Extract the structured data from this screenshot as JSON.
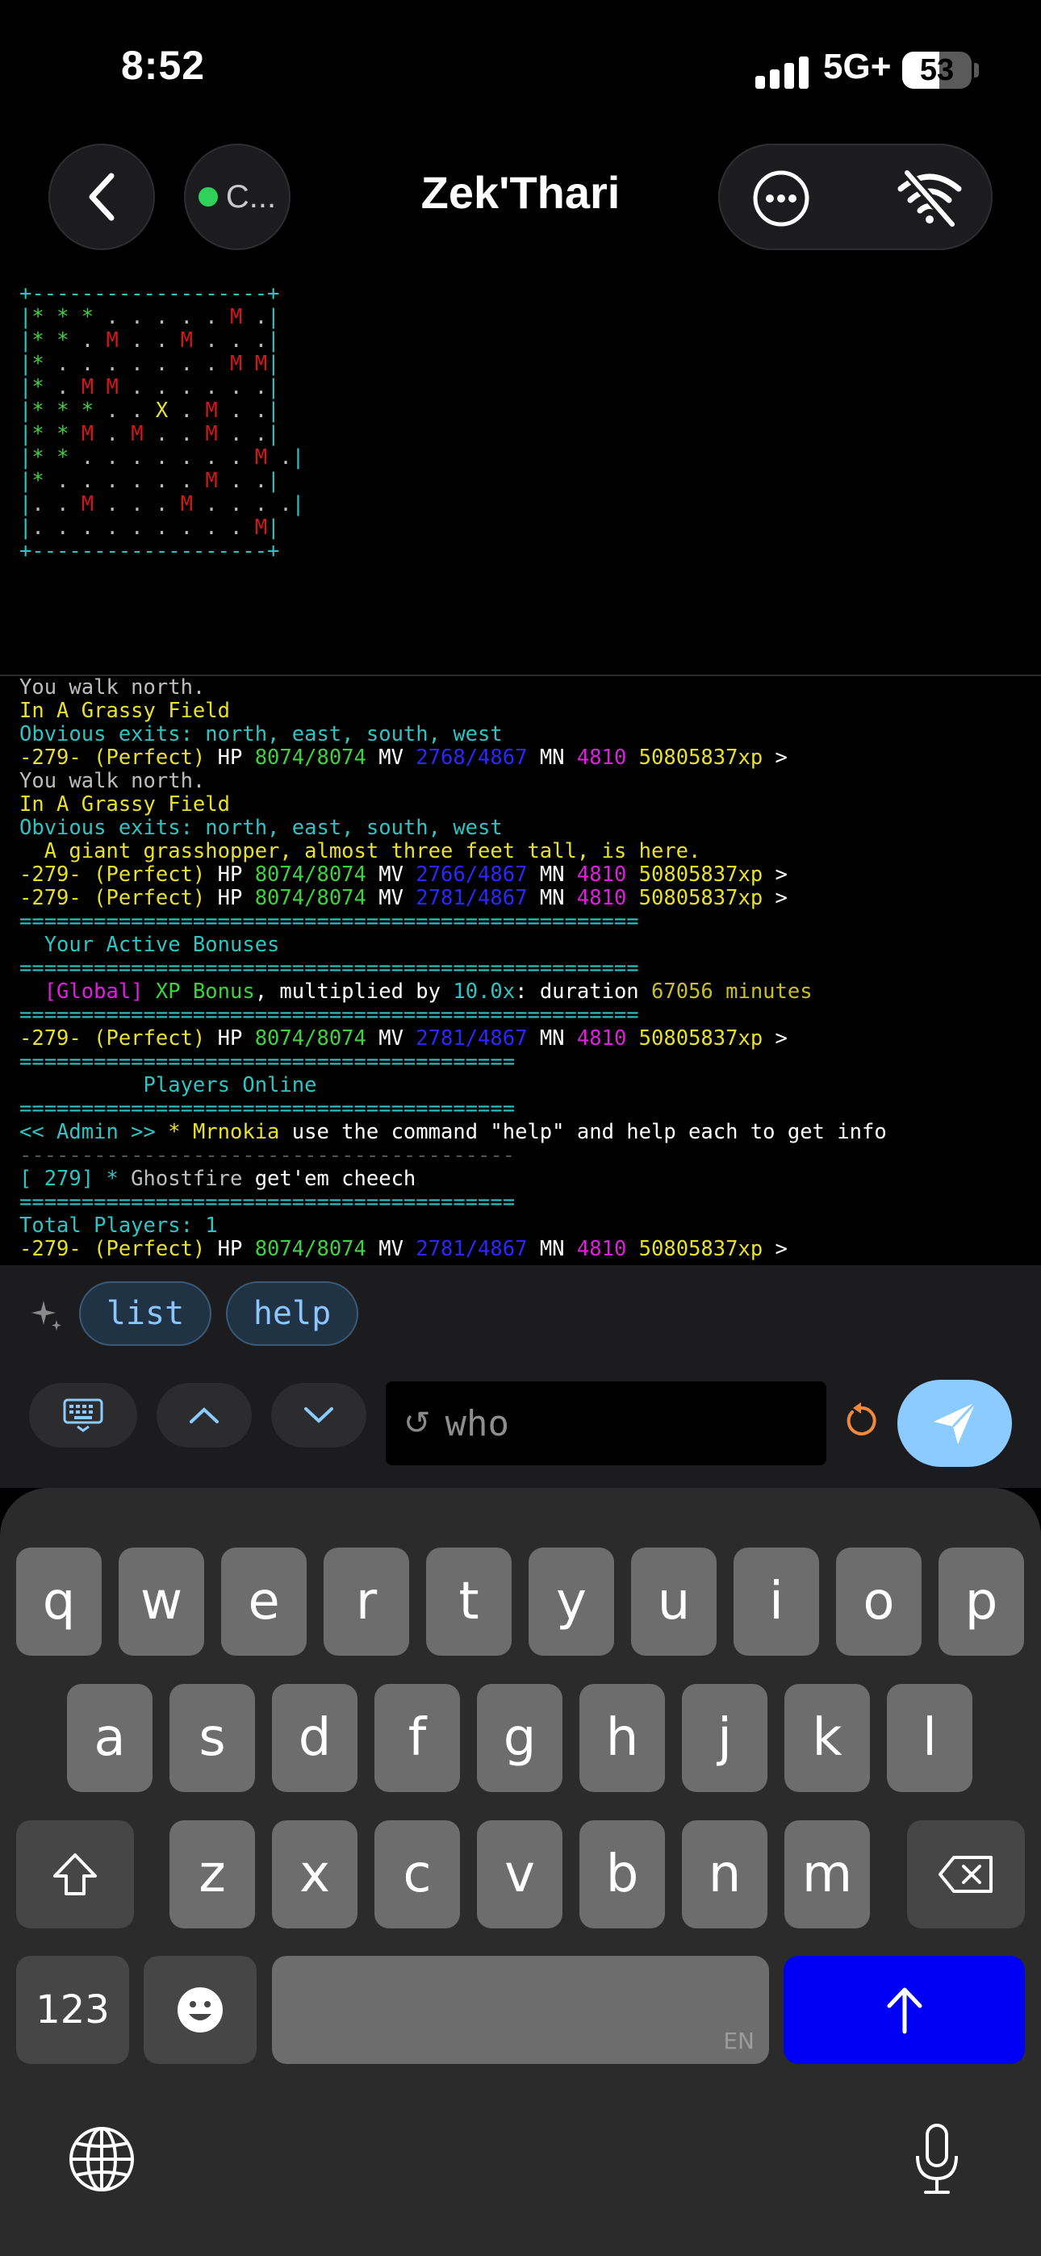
{
  "status_bar": {
    "time": "8:52",
    "network": "5G+",
    "battery": "53",
    "battery_level": 0.53
  },
  "nav": {
    "title": "Zek'Thari",
    "connection_label": "C..."
  },
  "map_lines": [
    [
      {
        "t": "+-------------------+",
        "c": "cyan"
      }
    ],
    [
      {
        "t": "|",
        "c": "cyan"
      },
      {
        "t": "* * * ",
        "c": "green"
      },
      {
        "t": ". . . . . ",
        "c": "gray"
      },
      {
        "t": "M",
        "c": "red"
      },
      {
        "t": " .",
        "c": "gray"
      },
      {
        "t": "|",
        "c": "cyan"
      }
    ],
    [
      {
        "t": "|",
        "c": "cyan"
      },
      {
        "t": "* * ",
        "c": "green"
      },
      {
        "t": ". ",
        "c": "gray"
      },
      {
        "t": "M",
        "c": "red"
      },
      {
        "t": " . . ",
        "c": "gray"
      },
      {
        "t": "M",
        "c": "red"
      },
      {
        "t": " . . .",
        "c": "gray"
      },
      {
        "t": "|",
        "c": "cyan"
      }
    ],
    [
      {
        "t": "|",
        "c": "cyan"
      },
      {
        "t": "* ",
        "c": "green"
      },
      {
        "t": ". . . . . . . ",
        "c": "gray"
      },
      {
        "t": "M M",
        "c": "red"
      },
      {
        "t": "|",
        "c": "cyan"
      }
    ],
    [
      {
        "t": "|",
        "c": "cyan"
      },
      {
        "t": "* ",
        "c": "green"
      },
      {
        "t": ". ",
        "c": "gray"
      },
      {
        "t": "M M",
        "c": "red"
      },
      {
        "t": " . . . . . .",
        "c": "gray"
      },
      {
        "t": "|",
        "c": "cyan"
      }
    ],
    [
      {
        "t": "|",
        "c": "cyan"
      },
      {
        "t": "* * * ",
        "c": "green"
      },
      {
        "t": ". . ",
        "c": "gray"
      },
      {
        "t": "X",
        "c": "yellow"
      },
      {
        "t": " . ",
        "c": "gray"
      },
      {
        "t": "M",
        "c": "red"
      },
      {
        "t": " . .",
        "c": "gray"
      },
      {
        "t": "|",
        "c": "cyan"
      }
    ],
    [
      {
        "t": "|",
        "c": "cyan"
      },
      {
        "t": "* * ",
        "c": "green"
      },
      {
        "t": "M",
        "c": "red"
      },
      {
        "t": " . ",
        "c": "gray"
      },
      {
        "t": "M",
        "c": "red"
      },
      {
        "t": " . . ",
        "c": "gray"
      },
      {
        "t": "M",
        "c": "red"
      },
      {
        "t": " . .",
        "c": "gray"
      },
      {
        "t": "|",
        "c": "cyan"
      }
    ],
    [
      {
        "t": "|",
        "c": "cyan"
      },
      {
        "t": "* * ",
        "c": "green"
      },
      {
        "t": ". . . . . . . ",
        "c": "gray"
      },
      {
        "t": "M",
        "c": "red"
      },
      {
        "t": " .",
        "c": "gray"
      },
      {
        "t": "|",
        "c": "cyan"
      }
    ],
    [
      {
        "t": "|",
        "c": "cyan"
      },
      {
        "t": "* ",
        "c": "green"
      },
      {
        "t": ". . . . . . ",
        "c": "gray"
      },
      {
        "t": "M",
        "c": "red"
      },
      {
        "t": " . .",
        "c": "gray"
      },
      {
        "t": "|",
        "c": "cyan"
      }
    ],
    [
      {
        "t": "|",
        "c": "cyan"
      },
      {
        "t": ". . ",
        "c": "gray"
      },
      {
        "t": "M",
        "c": "red"
      },
      {
        "t": " . . . ",
        "c": "gray"
      },
      {
        "t": "M",
        "c": "red"
      },
      {
        "t": " . . . .",
        "c": "gray"
      },
      {
        "t": "|",
        "c": "cyan"
      }
    ],
    [
      {
        "t": "|",
        "c": "cyan"
      },
      {
        "t": ". . . . . . . . . ",
        "c": "gray"
      },
      {
        "t": "M",
        "c": "red"
      },
      {
        "t": "|",
        "c": "cyan"
      }
    ],
    [
      {
        "t": "+-------------------+",
        "c": "cyan"
      }
    ]
  ],
  "output_lines": [
    [
      {
        "t": "You walk north.",
        "c": "gray"
      }
    ],
    [
      {
        "t": "In A Grassy Field",
        "c": "yellow"
      }
    ],
    [
      {
        "t": "Obvious exits: north, east, south, west",
        "c": "cyan"
      }
    ],
    [
      {
        "t": "-279- (Perfect) ",
        "c": "yellow"
      },
      {
        "t": "HP ",
        "c": "white"
      },
      {
        "t": "8074/8074",
        "c": "green"
      },
      {
        "t": " MV ",
        "c": "white"
      },
      {
        "t": "2768/4867",
        "c": "blue"
      },
      {
        "t": " MN ",
        "c": "white"
      },
      {
        "t": "4810",
        "c": "magenta"
      },
      {
        "t": " 50805837xp",
        "c": "yellow"
      },
      {
        "t": " >",
        "c": "white"
      }
    ],
    [
      {
        "t": "You walk north.",
        "c": "gray"
      }
    ],
    [
      {
        "t": "In A Grassy Field",
        "c": "yellow"
      }
    ],
    [
      {
        "t": "Obvious exits: north, east, south, west",
        "c": "cyan"
      }
    ],
    [
      {
        "t": "  A giant grasshopper, almost three feet tall, is here.",
        "c": "yellow"
      }
    ],
    [
      {
        "t": "-279- (Perfect) ",
        "c": "yellow"
      },
      {
        "t": "HP ",
        "c": "white"
      },
      {
        "t": "8074/8074",
        "c": "green"
      },
      {
        "t": " MV ",
        "c": "white"
      },
      {
        "t": "2766/4867",
        "c": "blue"
      },
      {
        "t": " MN ",
        "c": "white"
      },
      {
        "t": "4810",
        "c": "magenta"
      },
      {
        "t": " 50805837xp",
        "c": "yellow"
      },
      {
        "t": " >",
        "c": "white"
      }
    ],
    [
      {
        "t": "-279- (Perfect) ",
        "c": "yellow"
      },
      {
        "t": "HP ",
        "c": "white"
      },
      {
        "t": "8074/8074",
        "c": "green"
      },
      {
        "t": " MV ",
        "c": "white"
      },
      {
        "t": "2781/4867",
        "c": "blue"
      },
      {
        "t": " MN ",
        "c": "white"
      },
      {
        "t": "4810",
        "c": "magenta"
      },
      {
        "t": " 50805837xp",
        "c": "yellow"
      },
      {
        "t": " >",
        "c": "white"
      }
    ],
    [
      {
        "t": "==================================================",
        "c": "cyan"
      }
    ],
    [
      {
        "t": "  Your Active Bonuses",
        "c": "cyan"
      }
    ],
    [
      {
        "t": "==================================================",
        "c": "cyan"
      }
    ],
    [
      {
        "t": "  [Global] ",
        "c": "magenta"
      },
      {
        "t": "XP Bonus",
        "c": "green"
      },
      {
        "t": ", multiplied by ",
        "c": "white"
      },
      {
        "t": "10.0x",
        "c": "cyan"
      },
      {
        "t": ": duration ",
        "c": "white"
      },
      {
        "t": "67056 minutes",
        "c": "olive"
      }
    ],
    [
      {
        "t": "==================================================",
        "c": "cyan"
      }
    ],
    [
      {
        "t": "-279- (Perfect) ",
        "c": "yellow"
      },
      {
        "t": "HP ",
        "c": "white"
      },
      {
        "t": "8074/8074",
        "c": "green"
      },
      {
        "t": " MV ",
        "c": "white"
      },
      {
        "t": "2781/4867",
        "c": "blue"
      },
      {
        "t": " MN ",
        "c": "white"
      },
      {
        "t": "4810",
        "c": "magenta"
      },
      {
        "t": " 50805837xp",
        "c": "yellow"
      },
      {
        "t": " >",
        "c": "white"
      }
    ],
    [
      {
        "t": "========================================",
        "c": "cyan"
      }
    ],
    [
      {
        "t": "          Players Online",
        "c": "cyan"
      }
    ],
    [
      {
        "t": "========================================",
        "c": "cyan"
      }
    ],
    [
      {
        "t": "<< Admin >> ",
        "c": "cyan"
      },
      {
        "t": "* Mrnokia",
        "c": "yellow"
      },
      {
        "t": " use the command \"help\" and help each to get info",
        "c": "white"
      }
    ],
    [
      {
        "t": "----------------------------------------",
        "c": "dash"
      }
    ],
    [
      {
        "t": "[ 279] * ",
        "c": "cyan"
      },
      {
        "t": "Ghostfire",
        "c": "gray"
      },
      {
        "t": " get'em cheech",
        "c": "white"
      }
    ],
    [
      {
        "t": "========================================",
        "c": "cyan"
      }
    ],
    [
      {
        "t": "Total Players: 1",
        "c": "cyan"
      }
    ],
    [
      {
        "t": "-279- (Perfect) ",
        "c": "yellow"
      },
      {
        "t": "HP ",
        "c": "white"
      },
      {
        "t": "8074/8074",
        "c": "green"
      },
      {
        "t": " MV ",
        "c": "white"
      },
      {
        "t": "2781/4867",
        "c": "blue"
      },
      {
        "t": " MN ",
        "c": "white"
      },
      {
        "t": "4810",
        "c": "magenta"
      },
      {
        "t": " 50805837xp",
        "c": "yellow"
      },
      {
        "t": " >",
        "c": "white"
      }
    ]
  ],
  "colors": {
    "cyan": "#2ec4c4",
    "green": "#3ed23e",
    "red": "#d01818",
    "yellow": "#e8e02c",
    "gray": "#bdbdbd",
    "blue": "#2828ff",
    "magenta": "#e01ee0",
    "white": "#ffffff",
    "olive": "#c8be28",
    "dash": "#555555",
    "accent": "#8ccbff",
    "return_key": "#0000f5"
  },
  "quick_commands": [
    "list",
    "help"
  ],
  "command": {
    "value": "who"
  },
  "keyboard": {
    "row1": [
      "q",
      "w",
      "e",
      "r",
      "t",
      "y",
      "u",
      "i",
      "o",
      "p"
    ],
    "row2": [
      "a",
      "s",
      "d",
      "f",
      "g",
      "h",
      "j",
      "k",
      "l"
    ],
    "row3": [
      "z",
      "x",
      "c",
      "v",
      "b",
      "n",
      "m"
    ],
    "numbers_label": "123",
    "space_hint": "EN"
  }
}
